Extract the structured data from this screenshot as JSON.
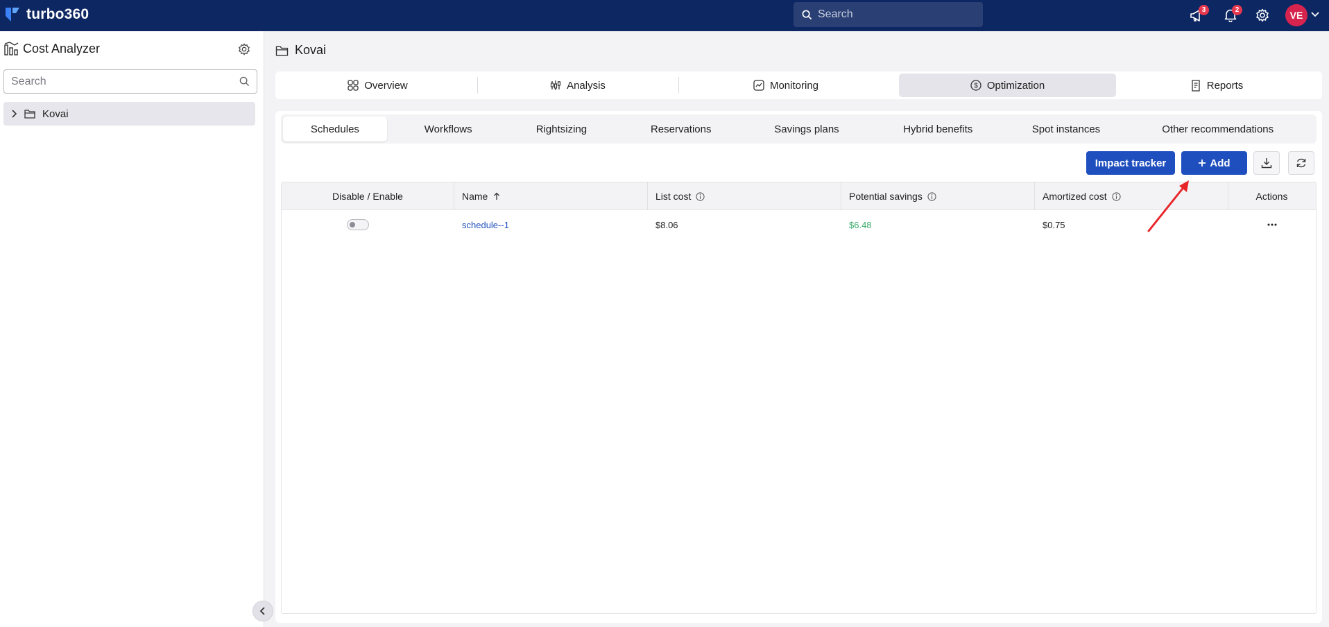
{
  "topbar": {
    "brand": "turbo360",
    "search_placeholder": "Search",
    "announcements_count": "3",
    "notifications_count": "2",
    "avatar_initials": "VE"
  },
  "sidebar": {
    "title": "Cost Analyzer",
    "search_placeholder": "Search",
    "tree": [
      {
        "label": "Kovai"
      }
    ]
  },
  "page": {
    "title": "Kovai"
  },
  "main_tabs": [
    {
      "label": "Overview",
      "icon": "grid-icon"
    },
    {
      "label": "Analysis",
      "icon": "analysis-icon"
    },
    {
      "label": "Monitoring",
      "icon": "monitoring-icon"
    },
    {
      "label": "Optimization",
      "icon": "dollar-circle-icon",
      "active": true
    },
    {
      "label": "Reports",
      "icon": "report-icon"
    }
  ],
  "sub_tabs": [
    {
      "label": "Schedules",
      "active": true
    },
    {
      "label": "Workflows"
    },
    {
      "label": "Rightsizing"
    },
    {
      "label": "Reservations"
    },
    {
      "label": "Savings plans"
    },
    {
      "label": "Hybrid benefits"
    },
    {
      "label": "Spot instances"
    },
    {
      "label": "Other recommendations"
    }
  ],
  "toolbar": {
    "impact_tracker_label": "Impact tracker",
    "add_label": "Add"
  },
  "table": {
    "columns": {
      "toggle": "Disable / Enable",
      "name": "Name",
      "list_cost": "List cost",
      "potential_savings": "Potential savings",
      "amortized_cost": "Amortized cost",
      "actions": "Actions"
    },
    "rows": [
      {
        "name": "schedule--1",
        "list_cost": "$8.06",
        "potential_savings": "$6.48",
        "amortized_cost": "$0.75",
        "enabled": false
      }
    ]
  },
  "colors": {
    "topbar": "#0d2763",
    "primary": "#1f4fbf",
    "savings": "#3bab6a",
    "annotation": "#e8262a"
  }
}
